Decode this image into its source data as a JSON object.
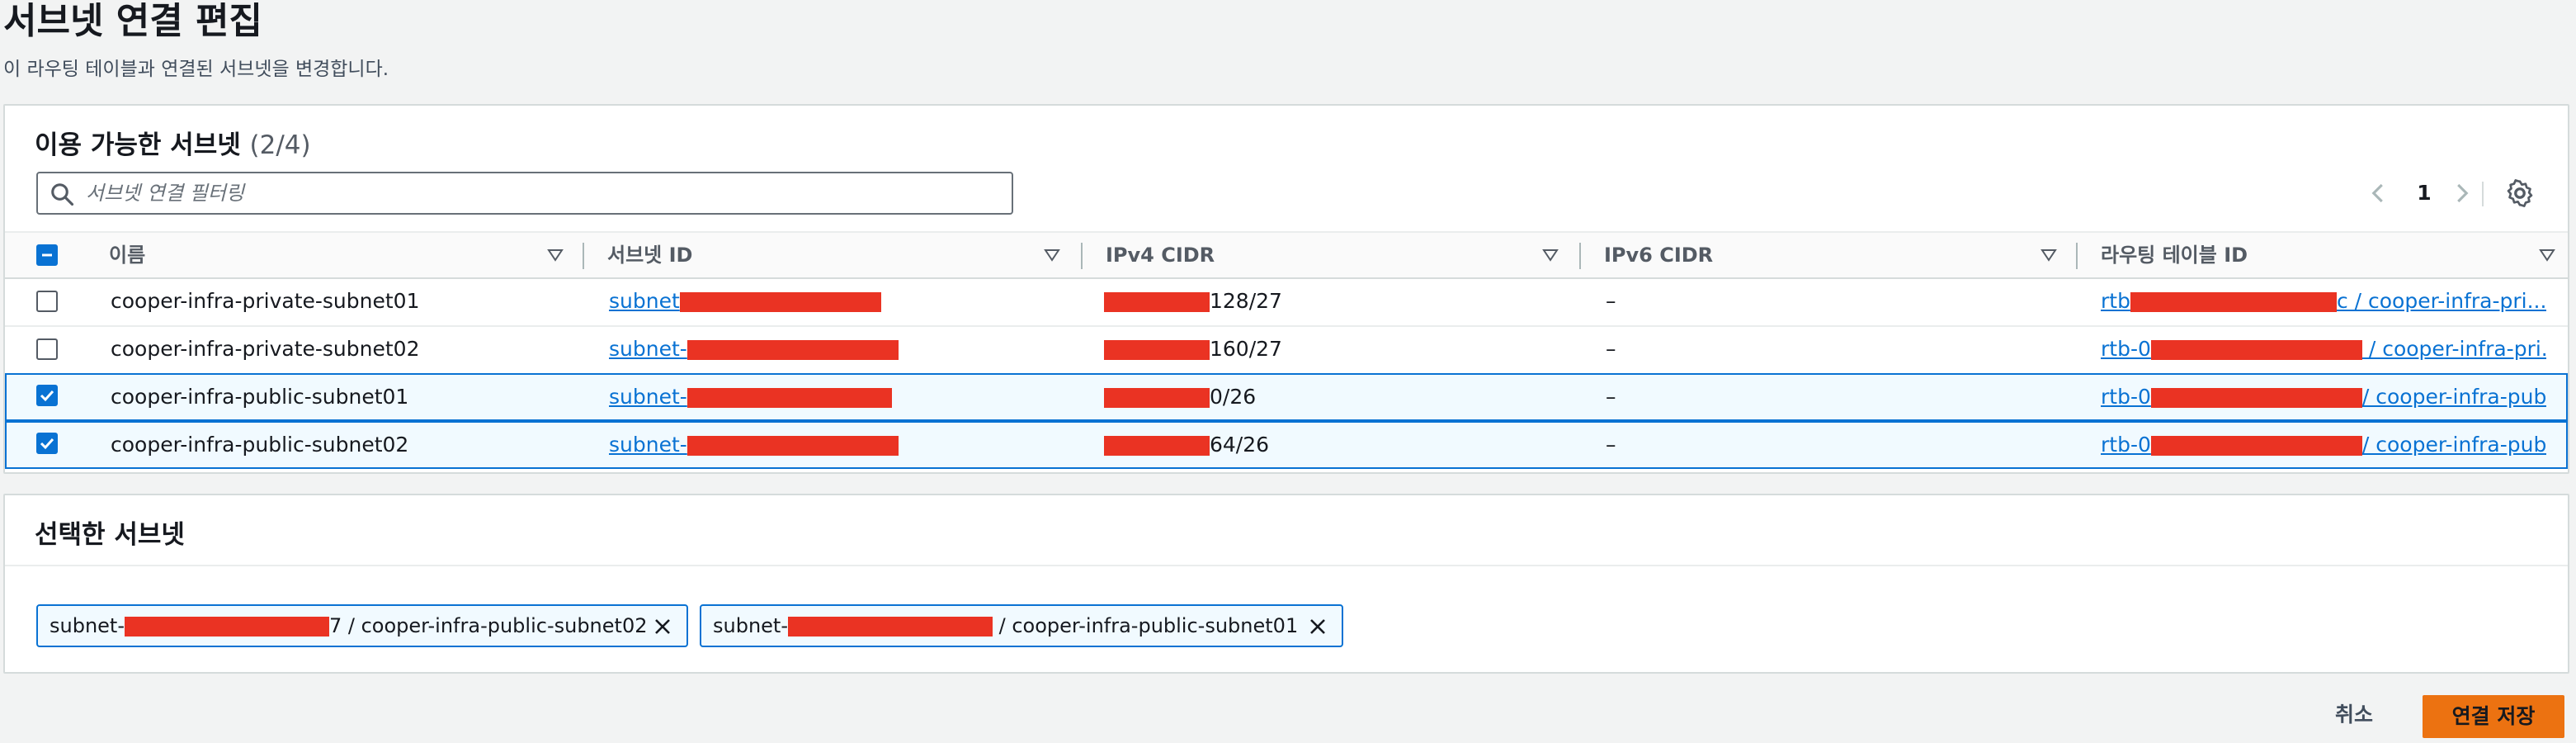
{
  "page": {
    "title": "서브넷 연결 편집",
    "description": "이 라우팅 테이블과 연결된 서브넷을 변경합니다."
  },
  "available": {
    "header": "이용 가능한 서브넷",
    "count": "(2/4)",
    "search_placeholder": "서브넷 연결 필터링",
    "page_number": "1",
    "columns": [
      "이름",
      "서브넷 ID",
      "IPv4 CIDR",
      "IPv6 CIDR",
      "라우팅 테이블 ID"
    ],
    "rows": [
      {
        "selected": false,
        "name": "cooper-infra-private-subnet01",
        "subnet_prefix": "subnet",
        "cidr_suffix": "128/27",
        "ipv6": "–",
        "rtb_prefix": "rtb",
        "rtb_suffix": "c / cooper-infra-pri..."
      },
      {
        "selected": false,
        "name": "cooper-infra-private-subnet02",
        "subnet_prefix": "subnet-",
        "cidr_suffix": "160/27",
        "ipv6": "–",
        "rtb_prefix": "rtb-0",
        "rtb_suffix": " / cooper-infra-pri..."
      },
      {
        "selected": true,
        "name": "cooper-infra-public-subnet01",
        "subnet_prefix": "subnet-",
        "cidr_suffix": "0/26",
        "ipv6": "–",
        "rtb_prefix": "rtb-0",
        "rtb_suffix": "/ cooper-infra-pub..."
      },
      {
        "selected": true,
        "name": "cooper-infra-public-subnet02",
        "subnet_prefix": "subnet-",
        "cidr_suffix": "64/26",
        "ipv6": "–",
        "rtb_prefix": "rtb-0",
        "rtb_suffix": "/ cooper-infra-pub..."
      }
    ]
  },
  "selected": {
    "header": "선택한 서브넷",
    "tokens": [
      {
        "prefix": "subnet-",
        "suffix": "7 / cooper-infra-public-subnet02"
      },
      {
        "prefix": "subnet-",
        "suffix": " / cooper-infra-public-subnet01"
      }
    ]
  },
  "footer": {
    "cancel_label": "취소",
    "save_label": "연결 저장"
  },
  "colors": {
    "accent": "#0972d3",
    "primary_button": "#ec7211",
    "redaction": "#ea3323"
  }
}
